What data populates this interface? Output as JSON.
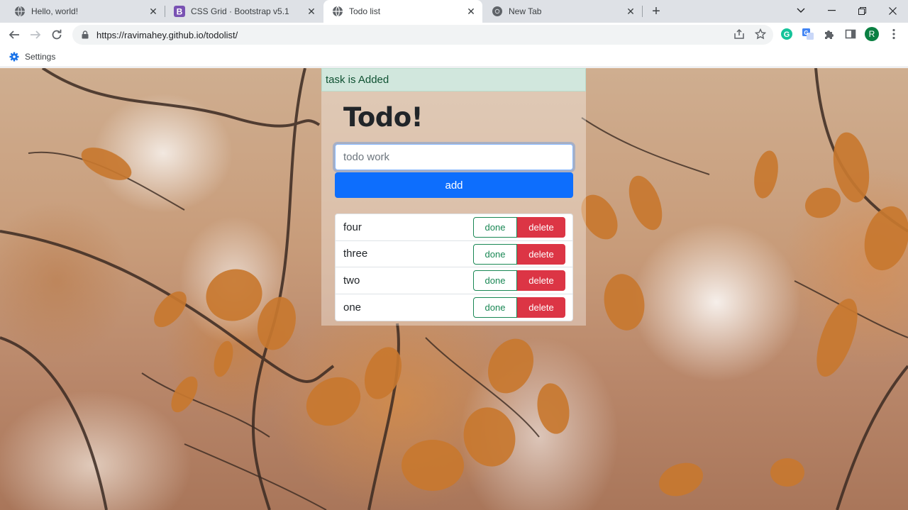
{
  "browser": {
    "tabs": [
      {
        "title": "Hello, world!",
        "icon": "globe-icon"
      },
      {
        "title": "CSS Grid · Bootstrap v5.1",
        "icon": "bootstrap-icon"
      },
      {
        "title": "Todo list",
        "icon": "globe-icon"
      },
      {
        "title": "New Tab",
        "icon": "chrome-icon"
      }
    ],
    "url": "https://ravimahey.github.io/todolist/",
    "bookmark_label": "Settings",
    "profile_initial": "R",
    "colors": {
      "tabbar": "#dee1e6",
      "grammarly": "#15c39a",
      "profile": "#0b8043"
    }
  },
  "page": {
    "alert": "task is Added",
    "title": "Todo!",
    "input_placeholder": "todo work",
    "add_label": "add",
    "done_label": "done",
    "delete_label": "delete",
    "todos": [
      "four",
      "three",
      "two",
      "one"
    ],
    "colors": {
      "primary": "#0d6efd",
      "success": "#198754",
      "danger": "#dc3545",
      "alert_bg": "#d1e7dd"
    }
  }
}
